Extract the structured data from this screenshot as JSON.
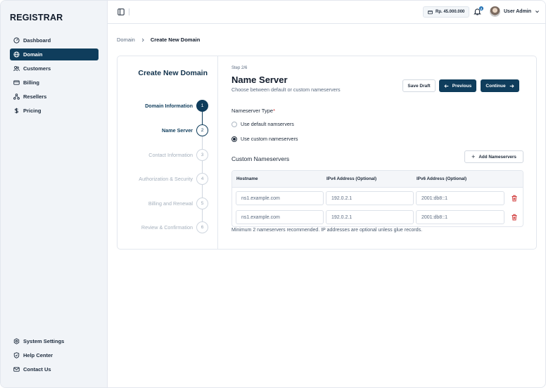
{
  "app": {
    "brand": "REGISTRAR"
  },
  "sidebar": {
    "items": [
      {
        "label": "Dashboard",
        "icon": "dashboard-icon"
      },
      {
        "label": "Domain",
        "icon": "globe-icon",
        "active": true
      },
      {
        "label": "Customers",
        "icon": "users-icon"
      },
      {
        "label": "Billing",
        "icon": "card-icon"
      },
      {
        "label": "Resellers",
        "icon": "network-icon"
      },
      {
        "label": "Pricing",
        "icon": "dollar-icon"
      }
    ],
    "bottom": [
      {
        "label": "System Settings",
        "icon": "gear-icon"
      },
      {
        "label": "Help Center",
        "icon": "shield-help-icon"
      },
      {
        "label": "Contact Us",
        "icon": "mail-icon"
      }
    ]
  },
  "topbar": {
    "balance": "Rp. 45.000.000",
    "notification_count": "2",
    "user_name": "User Admin"
  },
  "breadcrumb": {
    "parent": "Domain",
    "current": "Create New Domain"
  },
  "stepper": {
    "title": "Create New Domain",
    "steps": [
      {
        "label": "Domain Information",
        "num": "1",
        "state": "done"
      },
      {
        "label": "Name Server",
        "num": "2",
        "state": "current"
      },
      {
        "label": "Contact Information",
        "num": "3",
        "state": "todo"
      },
      {
        "label": "Authorization & Security",
        "num": "4",
        "state": "todo"
      },
      {
        "label": "Billing and Renewal",
        "num": "5",
        "state": "todo"
      },
      {
        "label": "Review & Confirmation",
        "num": "6",
        "state": "todo"
      }
    ]
  },
  "form": {
    "step_count": "Step 2/6",
    "title": "Name Server",
    "subtitle": "Choose between default or custom nameservers",
    "save_draft": "Save Draft",
    "previous": "Previous",
    "continue": "Continue",
    "ns_type_label": "Nameserver Type",
    "required_mark": "*",
    "options": [
      {
        "label": "Use default namservers",
        "checked": false
      },
      {
        "label": "Use custom nameservers",
        "checked": true
      }
    ],
    "custom_title": "Custom Nameservers",
    "add_button": "Add Nameservers",
    "table": {
      "headers": [
        "Hostname",
        "IPv4 Address (Optional)",
        "IPv6 Address (Optional)"
      ],
      "rows": [
        {
          "hostname": "ns1.example.com",
          "ipv4": "192.0.2.1",
          "ipv6": "2001:db8::1"
        },
        {
          "hostname": "ns1.example.com",
          "ipv4": "192.0.2.1",
          "ipv6": "2001:db8::1"
        }
      ]
    },
    "hint": "Minimum 2 nameservers recommended. IP addresses are optional unless glue records."
  },
  "colors": {
    "primary": "#0f3d5c",
    "danger": "#d03b3b",
    "sidebar_bg": "#f1f4f8"
  }
}
